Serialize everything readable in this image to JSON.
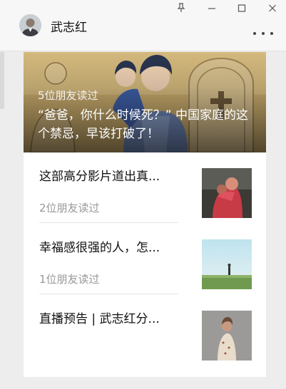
{
  "window": {
    "controls": {
      "pin": "⚲",
      "minimize": "—",
      "maximize": "☐",
      "close": "✕"
    }
  },
  "account": {
    "name": "武志红",
    "more_label": "更多"
  },
  "hero_article": {
    "friends_read": "5位朋友读过",
    "title": "“爸爸，你什么时候死？” 中国家庭的这个禁忌，早该打破了！"
  },
  "articles": [
    {
      "title": "这部高分影片道出真...",
      "friends_read": "2位朋友读过"
    },
    {
      "title": "幸福感很强的人，怎...",
      "friends_read": "1位朋友读过"
    },
    {
      "title": "直播预告 | 武志红分...",
      "friends_read": ""
    }
  ],
  "icons": {
    "pin": "pin-icon",
    "minimize": "minimize-icon",
    "maximize": "maximize-icon",
    "close": "close-icon",
    "more": "more-dots-icon"
  }
}
